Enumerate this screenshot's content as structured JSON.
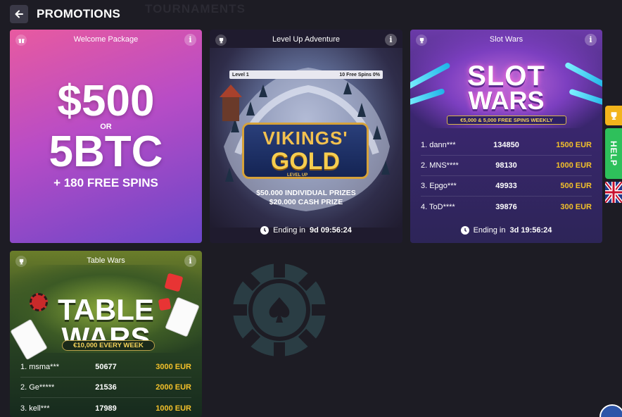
{
  "header": {
    "title": "PROMOTIONS",
    "ghost_title": "TOURNAMENTS"
  },
  "welcome": {
    "name": "Welcome Package",
    "amount": "$500",
    "or": "OR",
    "btc": "5BTC",
    "spins": "+ 180 FREE SPINS",
    "info": "i"
  },
  "vikings": {
    "name": "Level Up Adventure",
    "info": "i",
    "level": "Level 1",
    "progress_label": "10 Free Spins 0%",
    "progress_pct": 0,
    "logo_line1": "VIKINGS'",
    "logo_line2": "GOLD",
    "logo_tag": "LEVEL UP",
    "prize1": "$50.000 INDIVIDUAL PRIZES",
    "prize2": "$20.000 CASH PRIZE",
    "ending_label": "Ending in",
    "ending_value": "9d 09:56:24"
  },
  "slotwars": {
    "name": "Slot Wars",
    "info": "i",
    "logo_line1": "SLOT",
    "logo_line2": "WARS",
    "ribbon": "€5,000 & 5,000 FREE SPINS WEEKLY",
    "rows": [
      {
        "player": "1. dann***",
        "score": "134850",
        "prize": "1500 EUR"
      },
      {
        "player": "2. MNS****",
        "score": "98130",
        "prize": "1000 EUR"
      },
      {
        "player": "3. Epgo***",
        "score": "49933",
        "prize": "500 EUR"
      },
      {
        "player": "4. ToD****",
        "score": "39876",
        "prize": "300 EUR"
      }
    ],
    "ending_label": "Ending in",
    "ending_value": "3d 19:56:24"
  },
  "tablewars": {
    "name": "Table Wars",
    "info": "i",
    "logo_line1": "TABLE",
    "logo_line2": "WARS",
    "ribbon": "€10,000 EVERY WEEK",
    "rows": [
      {
        "player": "1. msma***",
        "score": "50677",
        "prize": "3000 EUR"
      },
      {
        "player": "2. Ge*****",
        "score": "21536",
        "prize": "2000 EUR"
      },
      {
        "player": "3. kell***",
        "score": "17989",
        "prize": "1000 EUR"
      }
    ]
  },
  "side": {
    "help": "HELP"
  },
  "colors": {
    "accent_gold": "#f3c12a",
    "help_green": "#2ec05b",
    "background": "#1d1c24"
  },
  "icons": [
    "arrow-left-icon",
    "gift-icon",
    "trophy-icon",
    "info-icon",
    "clock-icon",
    "poker-chip-icon",
    "uk-flag-icon",
    "chat-icon"
  ]
}
